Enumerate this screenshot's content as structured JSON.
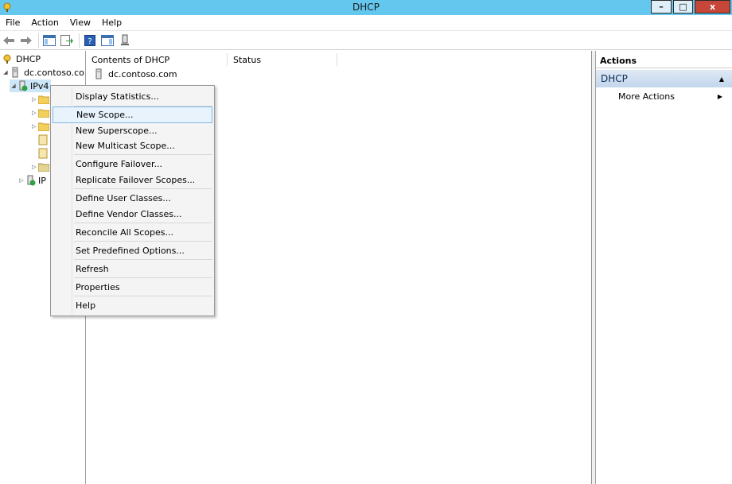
{
  "window": {
    "title": "DHCP",
    "minimize": "–",
    "maximize": "□",
    "close": "x"
  },
  "menu": [
    "File",
    "Action",
    "View",
    "Help"
  ],
  "tree": {
    "root": "DHCP",
    "server": "dc.contoso.co",
    "ipv4": "IPv4",
    "ipv6": "IP"
  },
  "center": {
    "columns": [
      "Contents of DHCP",
      "Status"
    ],
    "rows": [
      {
        "name": "dc.contoso.com",
        "status": ""
      }
    ]
  },
  "actions": {
    "header": "Actions",
    "group": "DHCP",
    "more": "More Actions"
  },
  "context_menu": [
    "Display Statistics...",
    "New Scope...",
    "New Superscope...",
    "New Multicast Scope...",
    "Configure Failover...",
    "Replicate Failover Scopes...",
    "Define User Classes...",
    "Define Vendor Classes...",
    "Reconcile All Scopes...",
    "Set Predefined Options...",
    "Refresh",
    "Properties",
    "Help"
  ]
}
